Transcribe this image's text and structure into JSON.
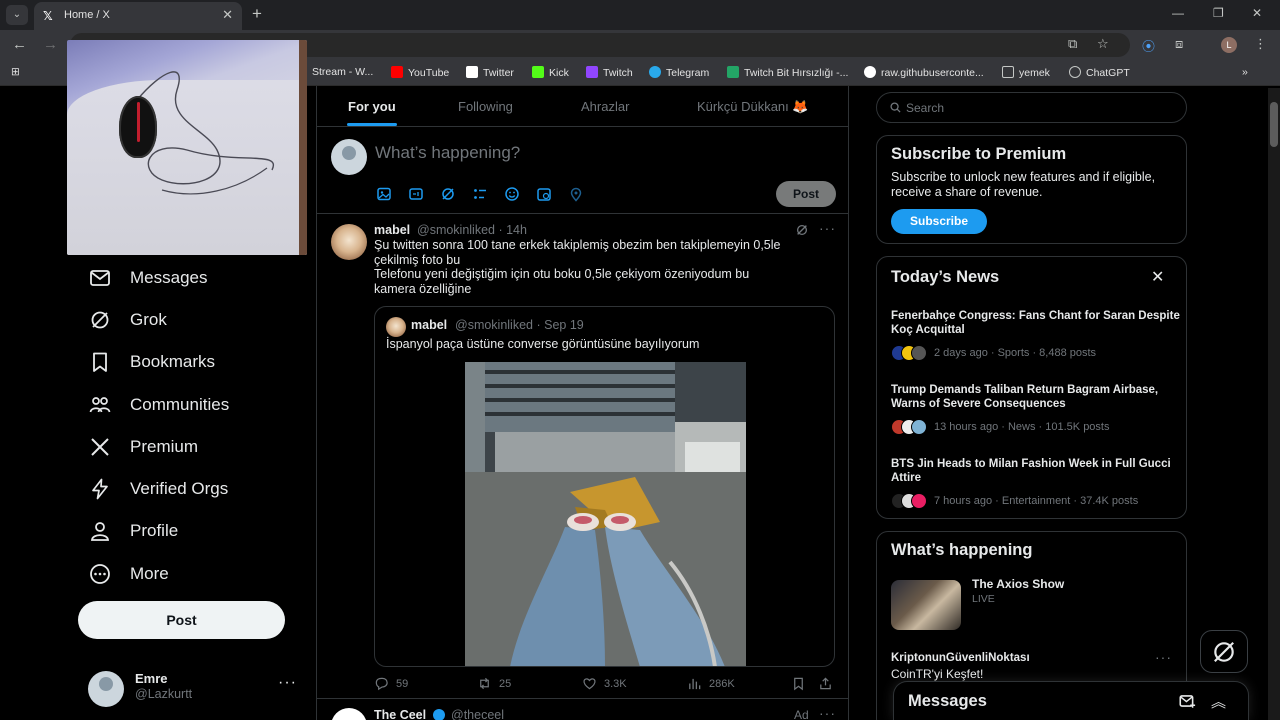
{
  "browser": {
    "tab_title": "Home / X",
    "tab_icon": "x-logo-icon",
    "profile_initial": "L",
    "bookmarks": [
      {
        "label": "Stream - W...",
        "icon": "bookmark-icon"
      },
      {
        "label": "YouTube",
        "icon": "youtube-icon",
        "color": "#ff0000"
      },
      {
        "label": "Twitter",
        "icon": "x-logo-icon"
      },
      {
        "label": "Kick",
        "icon": "kick-icon",
        "color": "#53fc18"
      },
      {
        "label": "Twitch",
        "icon": "twitch-icon",
        "color": "#9146ff"
      },
      {
        "label": "Telegram",
        "icon": "telegram-icon",
        "color": "#29a9eb"
      },
      {
        "label": "Twitch Bit Hırsızlığı -...",
        "icon": "sheet-icon",
        "color": "#23a566"
      },
      {
        "label": "raw.githubuserconte...",
        "icon": "github-icon"
      },
      {
        "label": "yemek",
        "icon": "folder-icon"
      },
      {
        "label": "ChatGPT",
        "icon": "chatgpt-icon"
      }
    ]
  },
  "sidebar": {
    "items": [
      {
        "label": "Messages",
        "icon": "mail-icon"
      },
      {
        "label": "Grok",
        "icon": "grok-icon"
      },
      {
        "label": "Bookmarks",
        "icon": "bookmark-icon"
      },
      {
        "label": "Communities",
        "icon": "communities-icon"
      },
      {
        "label": "Premium",
        "icon": "x-logo-icon"
      },
      {
        "label": "Verified Orgs",
        "icon": "lightning-icon"
      },
      {
        "label": "Profile",
        "icon": "person-icon"
      },
      {
        "label": "More",
        "icon": "more-circle-icon"
      }
    ],
    "post_label": "Post",
    "user": {
      "name": "Emre",
      "handle": "@Lazkurtt"
    }
  },
  "feed": {
    "tabs": [
      "For you",
      "Following",
      "Ahrazlar",
      "Kürkçü Dükkanı 🦊"
    ],
    "active_tab": "For you",
    "composer": {
      "placeholder": "What’s happening?",
      "post_label": "Post"
    },
    "tweet": {
      "name": "mabel",
      "handle": "@smokinliked",
      "time": "14h",
      "text_lines": [
        "Şu twitten sonra 100 tane erkek takiplemiş obezim ben takiplemeyin 0,5le",
        "çekilmiş foto bu",
        "Telefonu yeni değiştiğim için otu boku 0,5le çekiyom özeniyodum bu",
        "kamera özelliğine"
      ],
      "quote": {
        "name": "mabel",
        "handle": "@smokinliked",
        "time": "Sep 19",
        "text": "İspanyol paça üstüne converse görüntüsüne bayılıyorum"
      },
      "stats": {
        "replies": "59",
        "reposts": "25",
        "likes": "3.3K",
        "views": "286K"
      }
    },
    "next_tweet": {
      "name": "The Ceel",
      "handle": "@theceel",
      "ad_label": "Ad"
    }
  },
  "right": {
    "search_placeholder": "Search",
    "premium": {
      "title": "Subscribe to Premium",
      "description": "Subscribe to unlock new features and if eligible, receive a share of revenue.",
      "button": "Subscribe"
    },
    "news": {
      "title": "Today’s News",
      "items": [
        {
          "headline": "Fenerbahçe Congress: Fans Chant for Saran Despite Koç Acquittal",
          "meta": "2 days ago · Sports · 8,488 posts",
          "avatar_colors": [
            "#1f3a93",
            "#f1c40f",
            "#555"
          ]
        },
        {
          "headline": "Trump Demands Taliban Return Bagram Airbase, Warns of Severe Consequences",
          "meta": "13 hours ago · News · 101.5K posts",
          "avatar_colors": [
            "#c0392b",
            "#eee",
            "#7fb3d5"
          ]
        },
        {
          "headline": "BTS Jin Heads to Milan Fashion Week in Full Gucci Attire",
          "meta": "7 hours ago · Entertainment · 37.4K posts",
          "avatar_colors": [
            "#222",
            "#ddd",
            "#e91e63"
          ]
        }
      ]
    },
    "happening": {
      "title": "What’s happening",
      "item1": {
        "title": "The Axios Show",
        "sub": "LIVE"
      },
      "item2": {
        "title": "KriptonunGüvenliNoktası",
        "sub": "CoinTR'yi Keşfet!"
      }
    },
    "messages_drawer": "Messages"
  },
  "colors": {
    "accent": "#1d9bf0",
    "background": "#000000",
    "text": "#e7e9ea",
    "muted": "#71767b",
    "border": "#2f3336"
  }
}
